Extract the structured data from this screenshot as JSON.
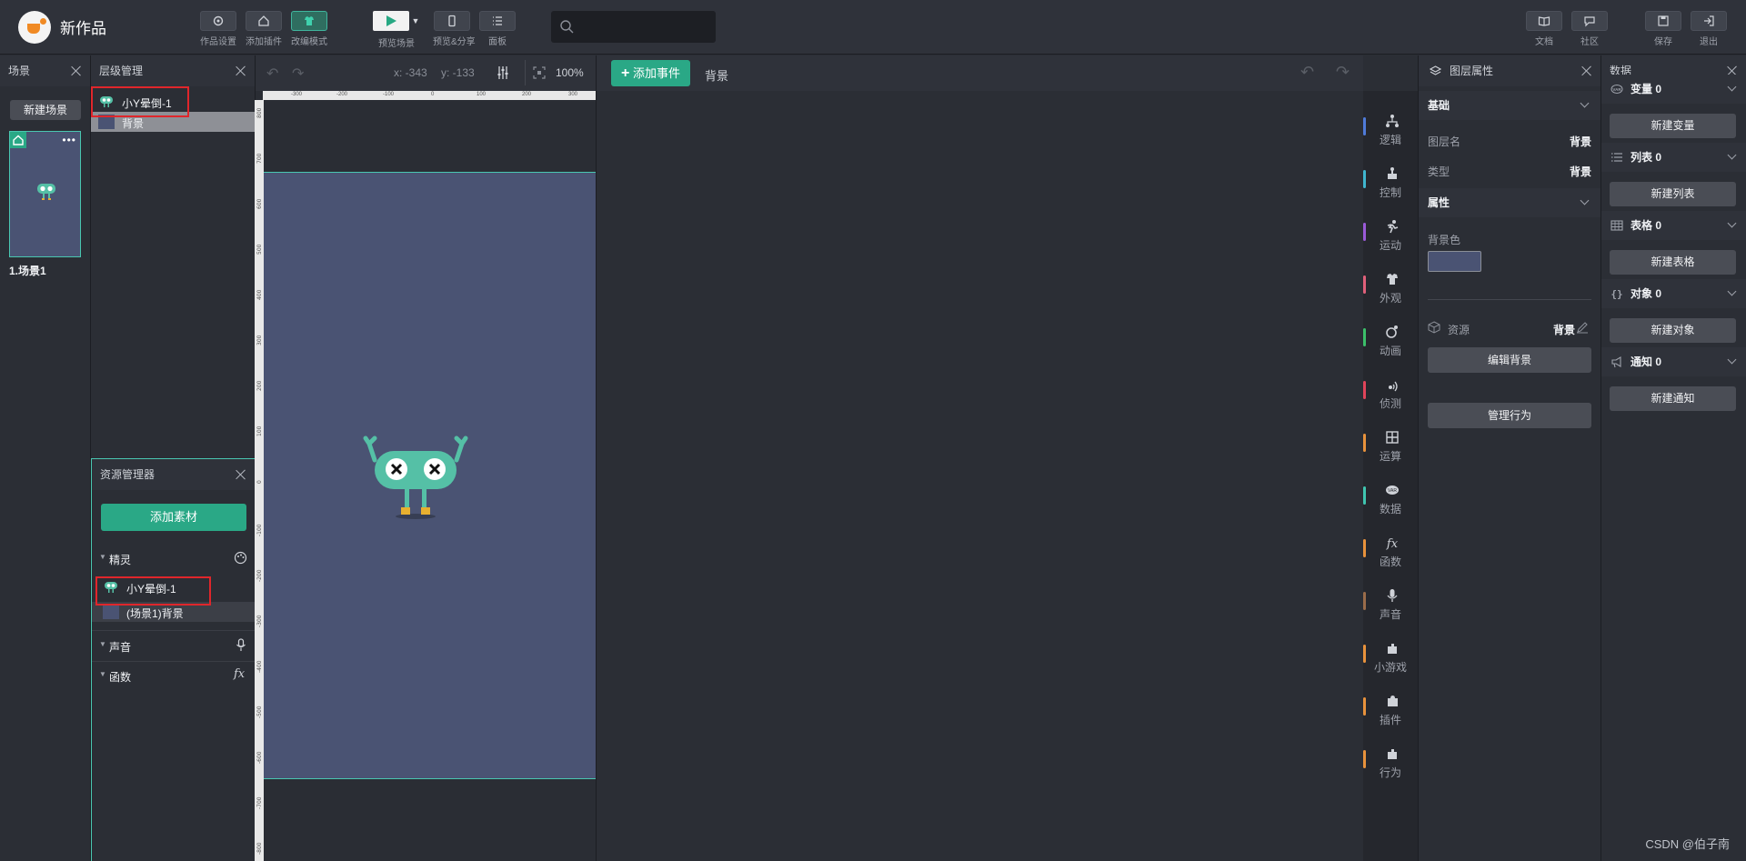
{
  "app": {
    "title": "新作品"
  },
  "toolbar": {
    "items": [
      {
        "label": "作品设置",
        "icon": "gear-icon"
      },
      {
        "label": "添加插件",
        "icon": "plugin-icon"
      },
      {
        "label": "改编模式",
        "icon": "shirt-icon"
      },
      {
        "label": "预览场景",
        "icon": "play-icon"
      },
      {
        "label": "预览&分享",
        "icon": "phone-icon"
      },
      {
        "label": "面板",
        "icon": "list-icon"
      }
    ],
    "right": [
      {
        "label": "文档",
        "icon": "book-icon"
      },
      {
        "label": "社区",
        "icon": "chat-icon"
      },
      {
        "label": "保存",
        "icon": "save-icon"
      },
      {
        "label": "退出",
        "icon": "exit-icon"
      }
    ],
    "search_placeholder": ""
  },
  "scene_panel": {
    "title": "场景",
    "new_scene": "新建场景",
    "scenes": [
      {
        "label": "1.场景1"
      }
    ]
  },
  "layer_panel": {
    "title": "层级管理",
    "items": [
      {
        "label": "小Y晕倒-1"
      },
      {
        "label": "背景"
      }
    ]
  },
  "asset_panel": {
    "title": "资源管理器",
    "add_button": "添加素材",
    "groups": [
      {
        "label": "精灵",
        "items": [
          "小Y晕倒-1",
          "(场景1)背景"
        ]
      },
      {
        "label": "声音"
      },
      {
        "label": "函数"
      }
    ]
  },
  "stage": {
    "coord_x": "x: -343",
    "coord_y": "y: -133",
    "zoom": "100%",
    "ruler_h_ticks": [
      "-300",
      "-200",
      "-100",
      "0",
      "100",
      "200",
      "300"
    ],
    "ruler_v_ticks": [
      "800",
      "700",
      "600",
      "500",
      "400",
      "300",
      "200",
      "100",
      "0",
      "-100",
      "-200",
      "-300",
      "-400",
      "-500",
      "-600",
      "-700",
      "-800"
    ],
    "background_color": "#4a5373",
    "sprite_color": "#55c0a6"
  },
  "event_area": {
    "add_event": "添加事件",
    "target": "背景"
  },
  "categories": [
    {
      "label": "逻辑",
      "color": "#4f7bd9",
      "icon": "logic-icon"
    },
    {
      "label": "控制",
      "color": "#3fb6cf",
      "icon": "control-icon"
    },
    {
      "label": "运动",
      "color": "#9a5ad8",
      "icon": "run-icon"
    },
    {
      "label": "外观",
      "color": "#e0607a",
      "icon": "shirt-icon"
    },
    {
      "label": "动画",
      "color": "#3cbf6a",
      "icon": "animation-icon"
    },
    {
      "label": "侦测",
      "color": "#e0445a",
      "icon": "sensor-icon"
    },
    {
      "label": "运算",
      "color": "#e8923c",
      "icon": "calc-icon"
    },
    {
      "label": "数据",
      "color": "#3fc5b0",
      "icon": "data-icon"
    },
    {
      "label": "函数",
      "color": "#e8923c",
      "icon": "function-icon"
    },
    {
      "label": "声音",
      "color": "#9a6c4a",
      "icon": "mic-icon"
    },
    {
      "label": "小游戏",
      "color": "#e8923c",
      "icon": "game-icon"
    },
    {
      "label": "插件",
      "color": "#e8923c",
      "icon": "puzzle-icon"
    },
    {
      "label": "行为",
      "color": "#e8923c",
      "icon": "behavior-icon"
    }
  ],
  "props_panel": {
    "title": "图层属性",
    "basic": "基础",
    "layer_name_label": "图层名",
    "layer_name_value": "背景",
    "type_label": "类型",
    "type_value": "背景",
    "attrs": "属性",
    "bg_color_label": "背景色",
    "bg_color": "#4a5373",
    "resource_label": "资源",
    "resource_value": "背景",
    "edit_bg": "编辑背景",
    "manage_behavior": "管理行为"
  },
  "data_panel": {
    "title": "数据",
    "sections": [
      {
        "label": "变量 0",
        "button": "新建变量",
        "icon": "var-icon"
      },
      {
        "label": "列表 0",
        "button": "新建列表",
        "icon": "list-icon"
      },
      {
        "label": "表格 0",
        "button": "新建表格",
        "icon": "table-icon"
      },
      {
        "label": "对象 0",
        "button": "新建对象",
        "icon": "object-icon"
      },
      {
        "label": "通知 0",
        "button": "新建通知",
        "icon": "broadcast-icon"
      }
    ]
  },
  "watermark": "CSDN @伯子南"
}
